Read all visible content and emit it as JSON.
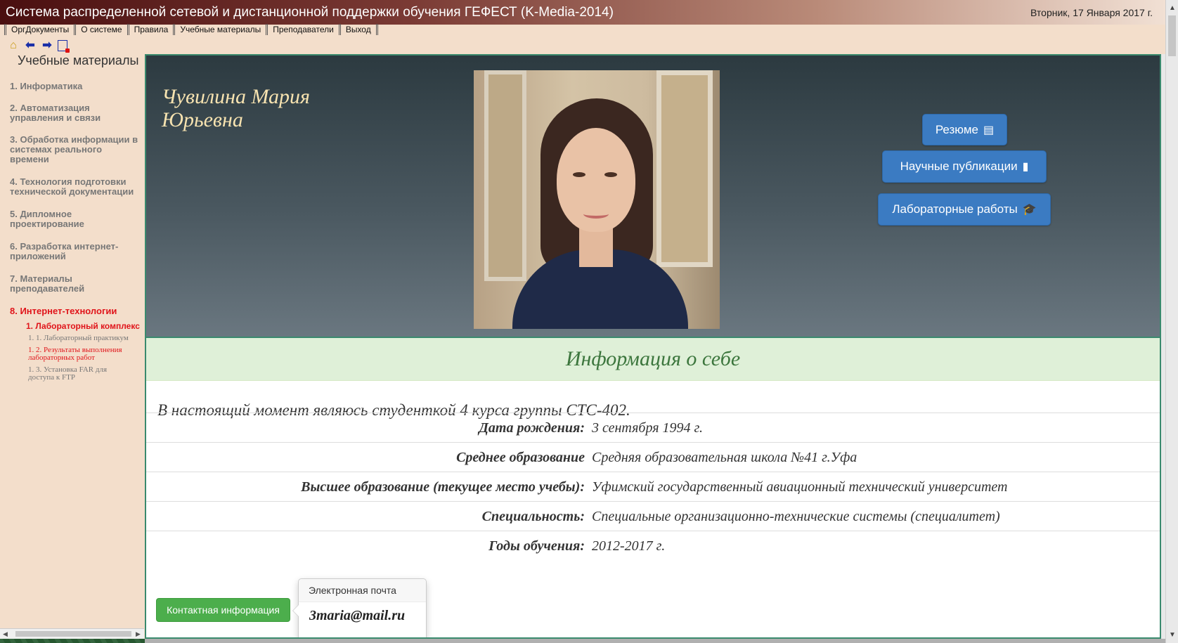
{
  "window": {
    "title": "Система распределенной сетевой и дистанционной поддержки обучения ГЕФЕСТ (K-Media-2014)",
    "date": "Вторник, 17 Января 2017 г."
  },
  "menu": {
    "items": [
      "ОргДокументы",
      "О системе",
      "Правила",
      "Учебные материалы",
      "Преподаватели",
      "Выход"
    ]
  },
  "toolbar": {
    "icons": [
      "home-icon",
      "back-arrow-icon",
      "forward-arrow-icon",
      "exit-icon"
    ]
  },
  "sidebar": {
    "title": "Учебные материалы",
    "items": [
      {
        "label": "1. Информатика"
      },
      {
        "label": "2. Автоматизация управления и связи"
      },
      {
        "label": "3. Обработка информации в системах реального времени"
      },
      {
        "label": "4. Технология подготовки технической документации"
      },
      {
        "label": "5. Дипломное проектирование"
      },
      {
        "label": "6. Разработка интернет-приложений"
      },
      {
        "label": "7. Материалы преподавателей"
      },
      {
        "label": "8. Интернет-технологии"
      }
    ],
    "sub": {
      "label": "1. Лабораторный комплекс"
    },
    "subsub": [
      {
        "label": "1. 1. Лабораторный практикум"
      },
      {
        "label": "1. 2. Результаты выполнения лабораторных работ"
      },
      {
        "label": "1. 3. Установка FAR для доступа к FTP"
      }
    ]
  },
  "profile": {
    "name": "Чувилина Мария Юрьевна",
    "buttons": {
      "resume": "Резюме",
      "publications": "Научные публикации",
      "labs": "Лабораторные работы"
    }
  },
  "info": {
    "heading": "Информация о себе",
    "intro": "В настоящий момент являюсь студенткой 4 курса группы СТС-402.",
    "rows": [
      {
        "label": "Дата рождения:",
        "value": "3 сентября 1994 г."
      },
      {
        "label": "Среднее образование",
        "value": "Средняя образовательная школа №41 г.Уфа"
      },
      {
        "label": "Высшее образование (текущее место учебы):",
        "value": "Уфимский государственный авиационный технический университет"
      },
      {
        "label": "Специальность:",
        "value": "Специальные организационно-технические системы (специалитет)"
      },
      {
        "label": "Годы обучения:",
        "value": "2012-2017 г."
      }
    ]
  },
  "contact": {
    "button": "Контактная информация",
    "popover_title": "Электронная почта",
    "email": "3maria@mail.ru"
  },
  "colors": {
    "accent_blue": "#3b7bc2",
    "success_green": "#4cae4c",
    "active_red": "#e0141a",
    "name_gold": "#f7e3b0"
  }
}
